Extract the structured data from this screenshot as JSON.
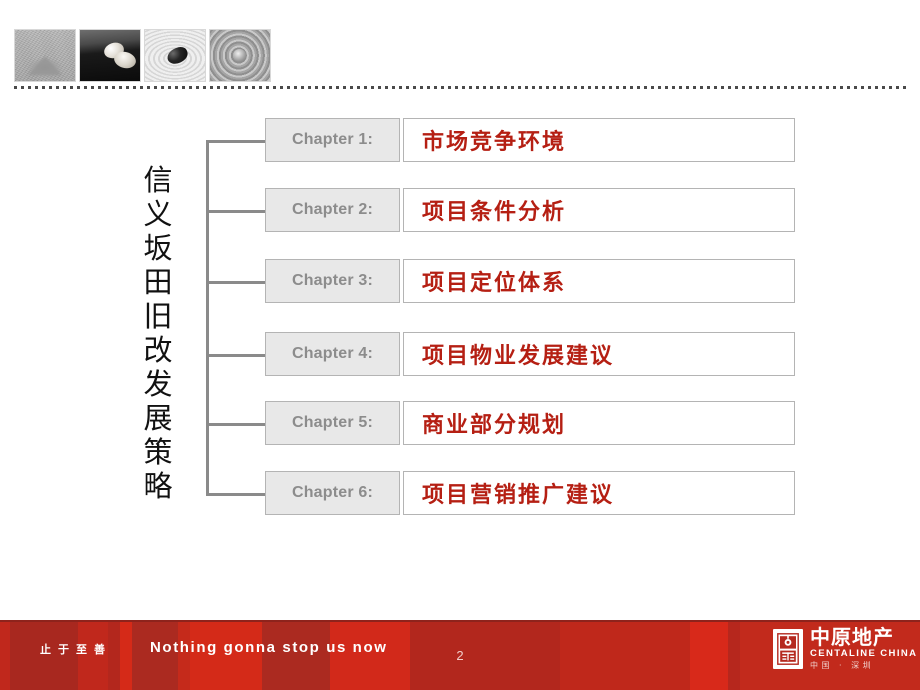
{
  "slide": {
    "page_number": "2",
    "vertical_title": "信义坂田旧改发展策略"
  },
  "header": {
    "thumbnails": [
      {
        "name": "sand-mound-photo",
        "alt": "sand-mound"
      },
      {
        "name": "white-stones-photo",
        "alt": "white-stones-on-dark-water"
      },
      {
        "name": "black-pebble-photo",
        "alt": "black-pebble-on-raked-sand"
      },
      {
        "name": "water-rings-photo",
        "alt": "concentric-water-ripples"
      }
    ]
  },
  "chapters": [
    {
      "label": "Chapter 1:",
      "title": "市场竞争环境"
    },
    {
      "label": "Chapter 2:",
      "title": "项目条件分析"
    },
    {
      "label": "Chapter 3:",
      "title": "项目定位体系"
    },
    {
      "label": "Chapter 4:",
      "title": "项目物业发展建议"
    },
    {
      "label": "Chapter 5:",
      "title": "商业部分规划"
    },
    {
      "label": "Chapter 6:",
      "title": "项目营销推广建议"
    }
  ],
  "footer": {
    "slogan_cn": "止于至善",
    "slogan_en": "Nothing gonna stop us now",
    "brand": {
      "name_cn": "中原地产",
      "name_en": "CENTALINE CHINA",
      "region_cn": "中国 · 深圳"
    }
  },
  "colors": {
    "footer_red": "#b5291f",
    "title_red": "#b51f13",
    "chapter_label_gray": "#8c8c8c",
    "chapter_box_fill": "#e8e8e8",
    "border_gray": "#b4b4b4",
    "connector_gray": "#8a8a8a"
  }
}
